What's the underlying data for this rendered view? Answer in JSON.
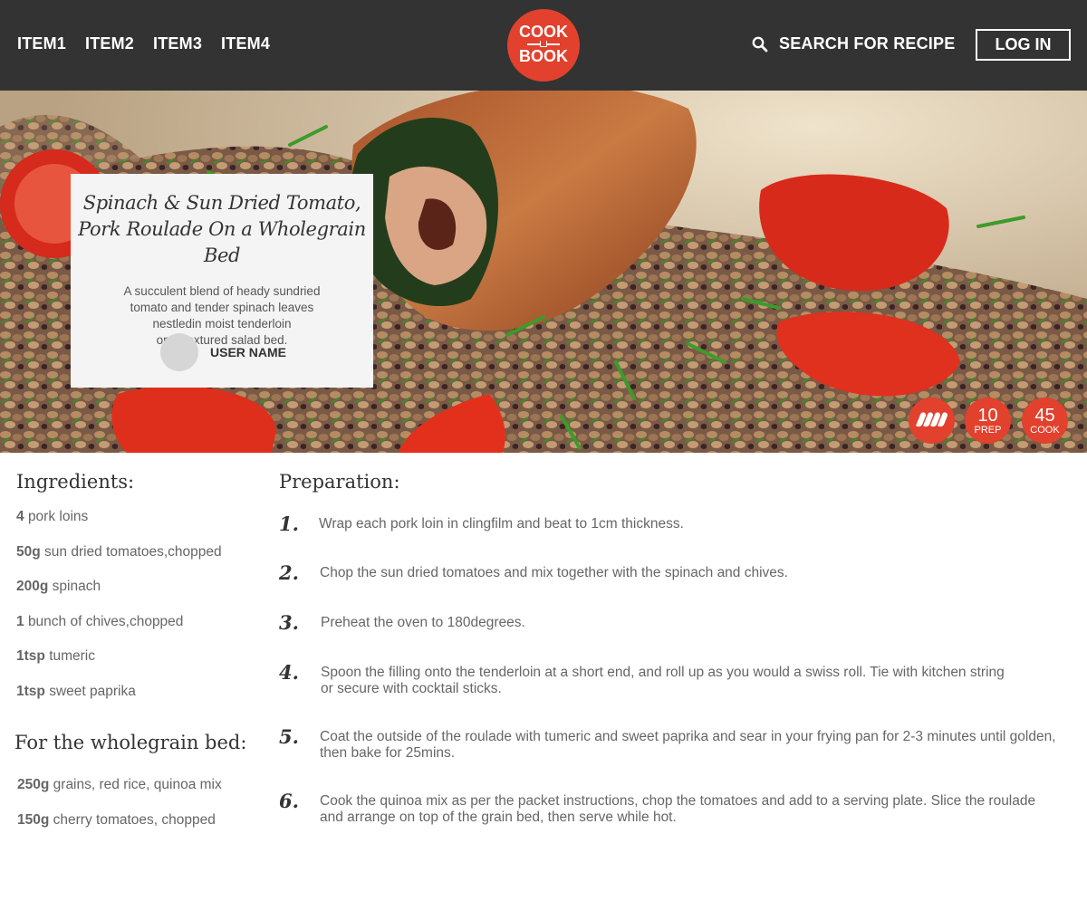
{
  "nav": [
    "ITEM1",
    "ITEM2",
    "ITEM3",
    "ITEM4"
  ],
  "logo": {
    "line1": "COOK",
    "line2": "BOOK"
  },
  "search_label": "SEARCH FOR RECIPE",
  "login_label": "LOG IN",
  "recipe": {
    "title": "Spinach & Sun Dried Tomato,\nPork Roulade On a Wholegrain Bed",
    "description": "A succulent blend of heady sundried\ntomato  and tender spinach leaves\nnestledin moist tenderloin\non a textured salad bed.",
    "user_name": "USER NAME",
    "spice_level": 4,
    "prep": {
      "value": "10",
      "label": "PREP"
    },
    "cook": {
      "value": "45",
      "label": "COOK"
    }
  },
  "ingredients": {
    "heading": "Ingredients:",
    "items": [
      {
        "qty": "4",
        "name": "pork loins"
      },
      {
        "qty": "50g",
        "name": "sun dried tomatoes,chopped"
      },
      {
        "qty": "200g",
        "name": "spinach"
      },
      {
        "qty": "1",
        "name": "bunch of chives,chopped"
      },
      {
        "qty": "1tsp",
        "name": "tumeric"
      },
      {
        "qty": "1tsp",
        "name": "sweet paprika"
      }
    ],
    "sub_heading": "For the wholegrain bed:",
    "sub_items": [
      {
        "qty": "250g",
        "name": "grains, red rice, quinoa mix"
      },
      {
        "qty": "150g",
        "name": "cherry tomatoes, chopped"
      }
    ]
  },
  "preparation": {
    "heading": "Preparation:",
    "steps": [
      {
        "n": "1.",
        "text": "Wrap each pork loin in clingfilm and beat to 1cm thickness."
      },
      {
        "n": "2.",
        "text": "Chop the sun dried tomatoes and mix together with the spinach and chives."
      },
      {
        "n": "3.",
        "text": "Preheat the oven to 180degrees."
      },
      {
        "n": "4.",
        "text": "Spoon the filling onto the tenderloin at a short end, and roll up as you would a swiss roll. Tie with kitchen string\nor secure with cocktail sticks."
      },
      {
        "n": "5.",
        "text": "Coat the outside of the roulade with tumeric and sweet paprika and sear in your frying pan for 2-3 minutes until golden,\nthen bake for 25mins."
      },
      {
        "n": "6.",
        "text": "Cook the quinoa mix as per the packet instructions, chop the tomatoes and add to a serving plate. Slice the roulade\nand arrange on top of the grain bed, then serve while hot."
      }
    ]
  },
  "colors": {
    "header_bg": "#333333",
    "accent": "#e2412d",
    "card_bg": "#f4f4f4"
  }
}
